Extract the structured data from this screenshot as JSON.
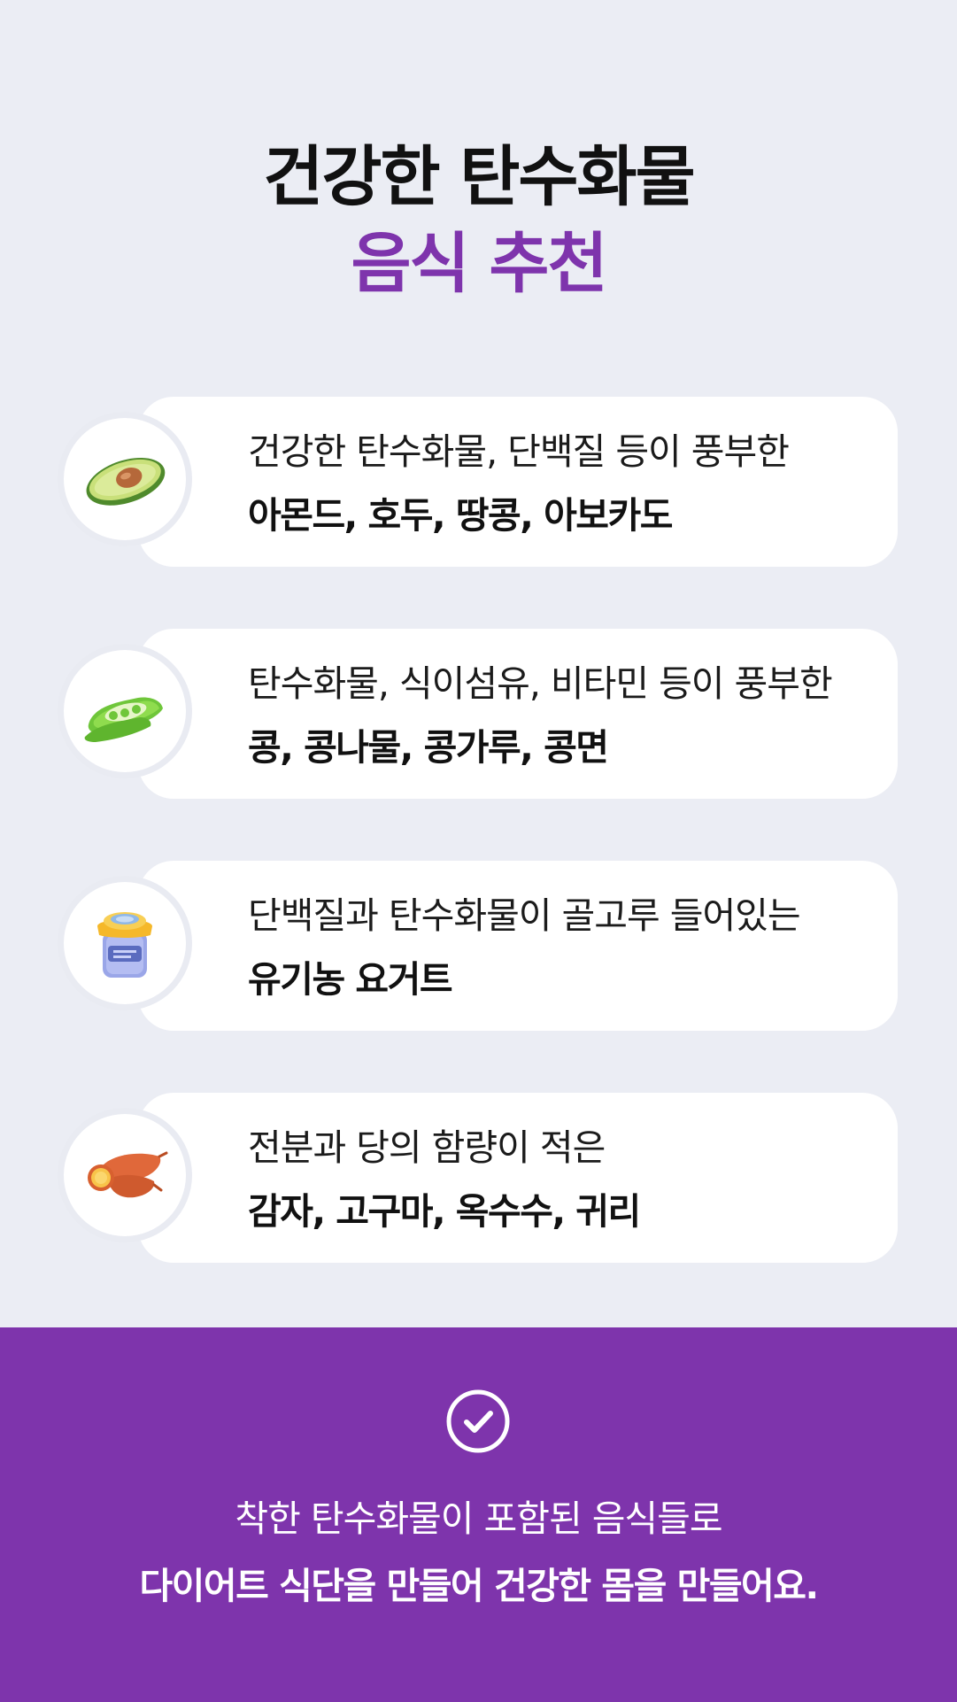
{
  "title": {
    "line1": "건강한 탄수화물",
    "line2": "음식 추천"
  },
  "colors": {
    "background": "#ebedf4",
    "accent": "#7e34ac",
    "card": "#ffffff"
  },
  "items": [
    {
      "icon": "avocado-icon",
      "description": "건강한 탄수화물, 단백질 등이 풍부한",
      "foods": "아몬드, 호두, 땅콩, 아보카도"
    },
    {
      "icon": "bean-pod-icon",
      "description": "탄수화물, 식이섬유, 비타민 등이 풍부한",
      "foods": "콩, 콩나물, 콩가루, 콩면"
    },
    {
      "icon": "yogurt-jar-icon",
      "description": "단백질과 탄수화물이 골고루 들어있는",
      "foods": "유기농 요거트"
    },
    {
      "icon": "sweet-potato-icon",
      "description": "전분과 당의 함량이 적은",
      "foods": "감자, 고구마, 옥수수, 귀리"
    }
  ],
  "footer": {
    "icon": "check-circle-icon",
    "line1": "착한 탄수화물이 포함된 음식들로",
    "line2": "다이어트 식단을 만들어 건강한 몸을 만들어요."
  }
}
